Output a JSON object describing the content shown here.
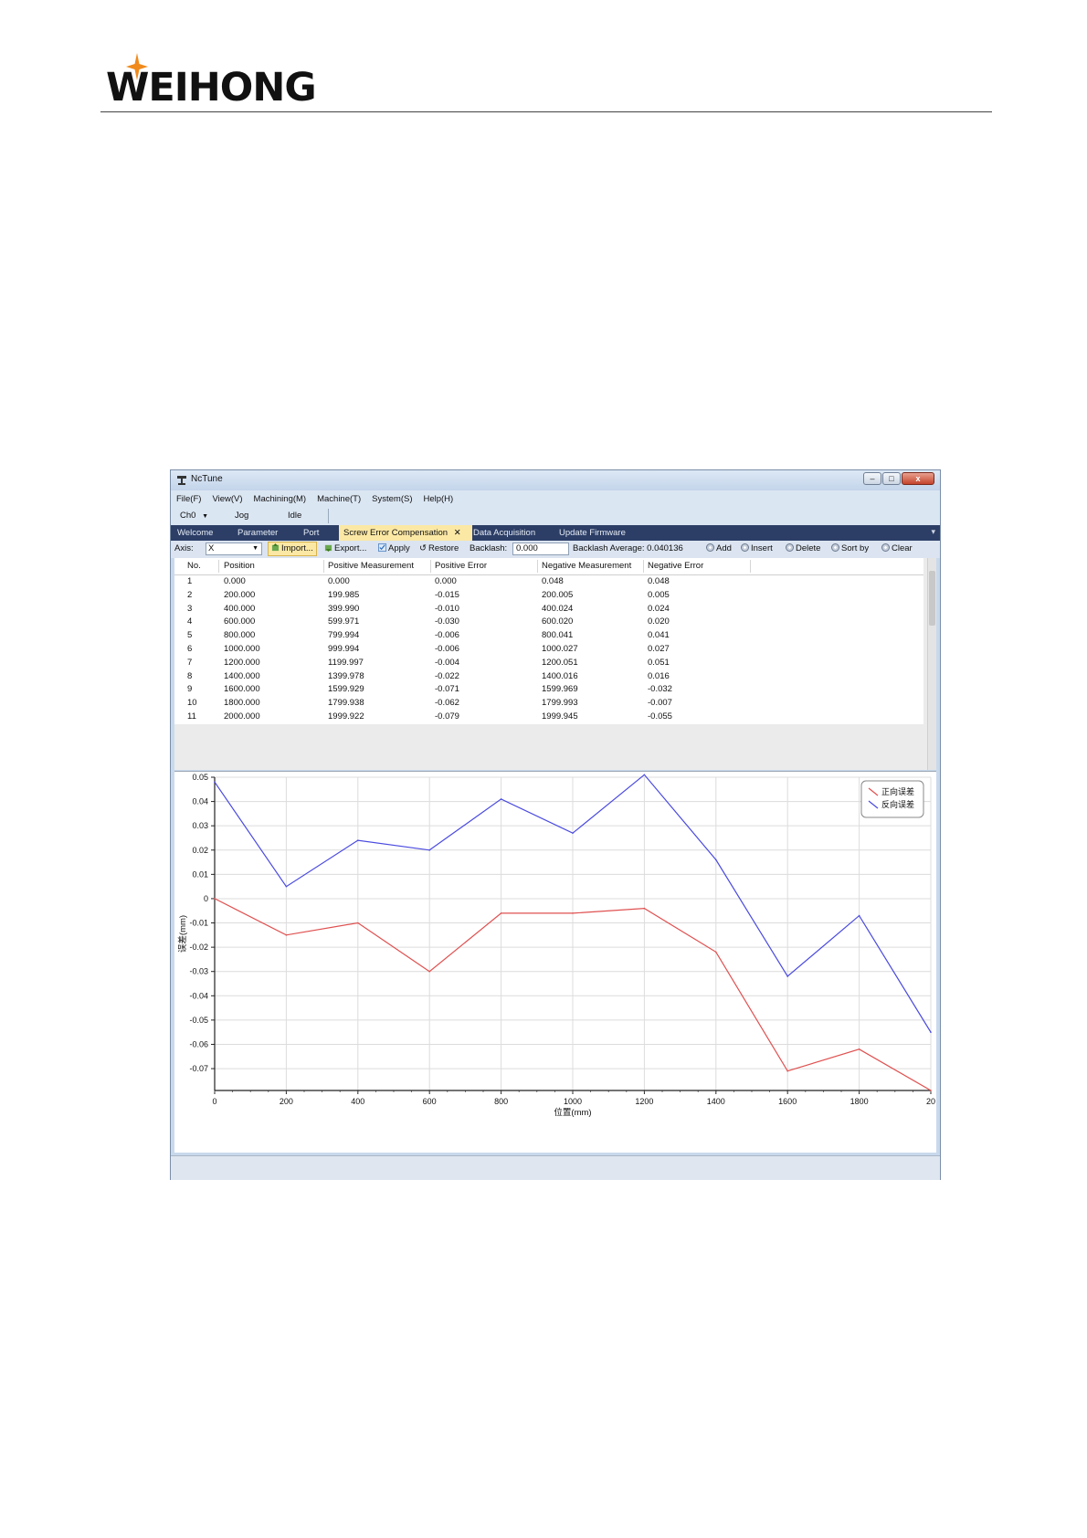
{
  "doc_header": {
    "logo_text": "WEIHONG"
  },
  "window": {
    "title": "NcTune",
    "menu": [
      "File(F)",
      "View(V)",
      "Machining(M)",
      "Machine(T)",
      "System(S)",
      "Help(H)"
    ],
    "status": {
      "channel": "Ch0",
      "mode": "Jog",
      "state": "Idle"
    },
    "tabs": [
      "Welcome",
      "Parameter",
      "Port",
      "Screw Error Compensation",
      "Data Acquisition",
      "Update Firmware"
    ],
    "active_tab": "Screw Error Compensation",
    "toolbar": {
      "axis_label": "Axis:",
      "axis_value": "X",
      "import_label": "Import...",
      "export_label": "Export...",
      "apply_label": "Apply",
      "restore_label": "Restore",
      "backlash_label": "Backlash:",
      "backlash_value": "0.000",
      "backlash_avg_label": "Backlash Average:",
      "backlash_avg_value": "0.040136",
      "add_label": "Add",
      "insert_label": "Insert",
      "delete_label": "Delete",
      "sort_label": "Sort by",
      "clear_label": "Clear"
    },
    "table": {
      "headers": [
        "No.",
        "Position",
        "Positive Measurement",
        "Positive Error",
        "Negative Measurement",
        "Negative Error"
      ],
      "rows": [
        [
          "1",
          "0.000",
          "0.000",
          "0.000",
          "0.048",
          "0.048"
        ],
        [
          "2",
          "200.000",
          "199.985",
          "-0.015",
          "200.005",
          "0.005"
        ],
        [
          "3",
          "400.000",
          "399.990",
          "-0.010",
          "400.024",
          "0.024"
        ],
        [
          "4",
          "600.000",
          "599.971",
          "-0.030",
          "600.020",
          "0.020"
        ],
        [
          "5",
          "800.000",
          "799.994",
          "-0.006",
          "800.041",
          "0.041"
        ],
        [
          "6",
          "1000.000",
          "999.994",
          "-0.006",
          "1000.027",
          "0.027"
        ],
        [
          "7",
          "1200.000",
          "1199.997",
          "-0.004",
          "1200.051",
          "0.051"
        ],
        [
          "8",
          "1400.000",
          "1399.978",
          "-0.022",
          "1400.016",
          "0.016"
        ],
        [
          "9",
          "1600.000",
          "1599.929",
          "-0.071",
          "1599.969",
          "-0.032"
        ],
        [
          "10",
          "1800.000",
          "1799.938",
          "-0.062",
          "1799.993",
          "-0.007"
        ],
        [
          "11",
          "2000.000",
          "1999.922",
          "-0.079",
          "1999.945",
          "-0.055"
        ]
      ]
    }
  },
  "chart_data": {
    "type": "line",
    "x": [
      0,
      200,
      400,
      600,
      800,
      1000,
      1200,
      1400,
      1600,
      1800,
      2000
    ],
    "series": [
      {
        "name": "正向误差",
        "color": "#e05050",
        "values": [
          0.0,
          -0.015,
          -0.01,
          -0.03,
          -0.006,
          -0.006,
          -0.004,
          -0.022,
          -0.071,
          -0.062,
          -0.079
        ]
      },
      {
        "name": "反向误差",
        "color": "#4a4ae0",
        "values": [
          0.048,
          0.005,
          0.024,
          0.02,
          0.041,
          0.027,
          0.051,
          0.016,
          -0.032,
          -0.007,
          -0.055
        ]
      }
    ],
    "xlabel": "位置(mm)",
    "ylabel": "误差(mm)",
    "xlim": [
      0,
      2000
    ],
    "ylim": [
      -0.079,
      0.05
    ],
    "xticks": [
      "0",
      "200",
      "400",
      "600",
      "800",
      "1000",
      "1200",
      "1400",
      "1600",
      "1800",
      "20"
    ],
    "yticks": [
      "0.05",
      "0.04",
      "0.03",
      "0.02",
      "0.01",
      "0",
      "-0.01",
      "-0.02",
      "-0.03",
      "-0.04",
      "-0.05",
      "-0.06",
      "-0.07"
    ],
    "grid": true,
    "legend_position": "top-right"
  }
}
